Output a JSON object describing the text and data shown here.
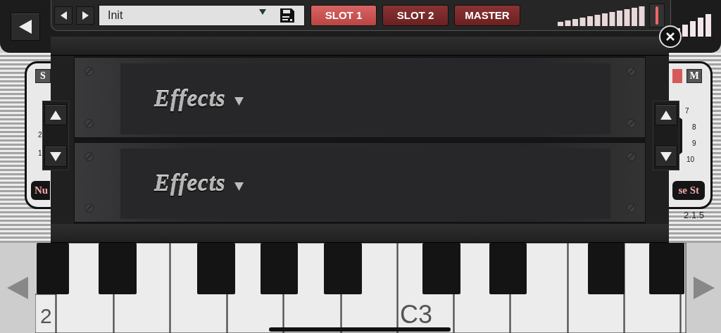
{
  "preset": {
    "name": "Init"
  },
  "slots": [
    {
      "label": "SLOT 1",
      "selected": true
    },
    {
      "label": "SLOT 2",
      "selected": false
    },
    {
      "label": "MASTER",
      "selected": false
    }
  ],
  "rack": {
    "units": [
      {
        "label": "Effects"
      },
      {
        "label": "Effects"
      }
    ]
  },
  "synth_panel": {
    "left_button": "S",
    "right_button": "M",
    "left_scale": [
      "2",
      "1"
    ],
    "right_scale": [
      "7",
      "8",
      "9",
      "10"
    ],
    "left_pill": "Nu",
    "right_pill": "se St",
    "version": "2.1.5"
  },
  "keyboard": {
    "labels": [
      "2",
      "C3"
    ]
  }
}
